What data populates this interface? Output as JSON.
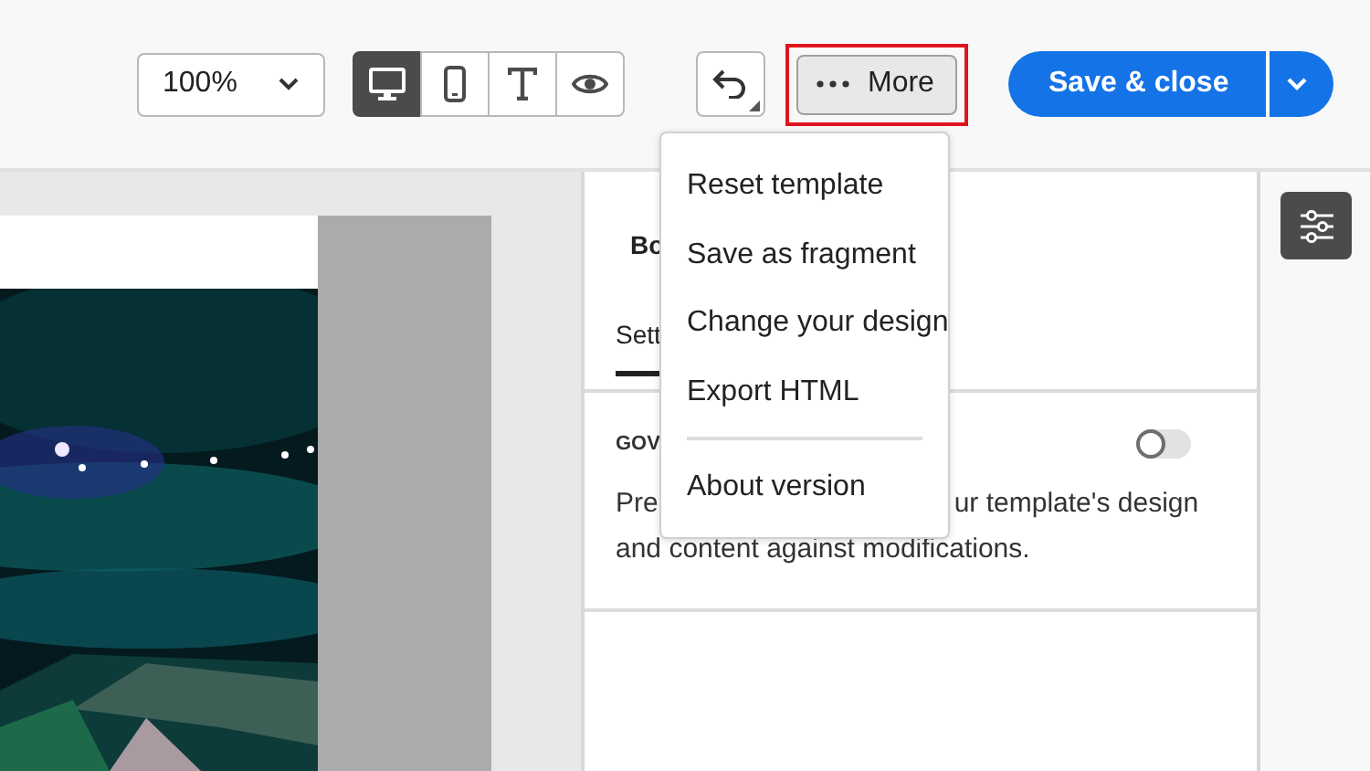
{
  "toolbar": {
    "zoom": {
      "value": "100%"
    },
    "views": [
      {
        "kind": "desktop",
        "selected": true
      },
      {
        "kind": "mobile",
        "selected": false
      },
      {
        "kind": "text",
        "selected": false
      },
      {
        "kind": "preview",
        "selected": false
      }
    ],
    "more_button": {
      "label": "More",
      "highlighted": true
    },
    "save_button": {
      "label": "Save & close"
    }
  },
  "more_menu": {
    "items": [
      {
        "kind": "item",
        "label": "Reset template"
      },
      {
        "kind": "item",
        "label": "Save as fragment"
      },
      {
        "kind": "item",
        "label": "Change your design"
      },
      {
        "kind": "item",
        "label": "Export HTML"
      },
      {
        "kind": "divider"
      },
      {
        "kind": "item",
        "label": "About version"
      }
    ]
  },
  "panel": {
    "title": "Bo",
    "tabs": [
      {
        "label": "Sett",
        "selected": true
      }
    ],
    "section": {
      "heading": "GOV",
      "toggle": {
        "on": false
      },
      "description_parts": [
        "Pre",
        "ur template's design"
      ],
      "description_line_2": "and content against modifications."
    }
  }
}
